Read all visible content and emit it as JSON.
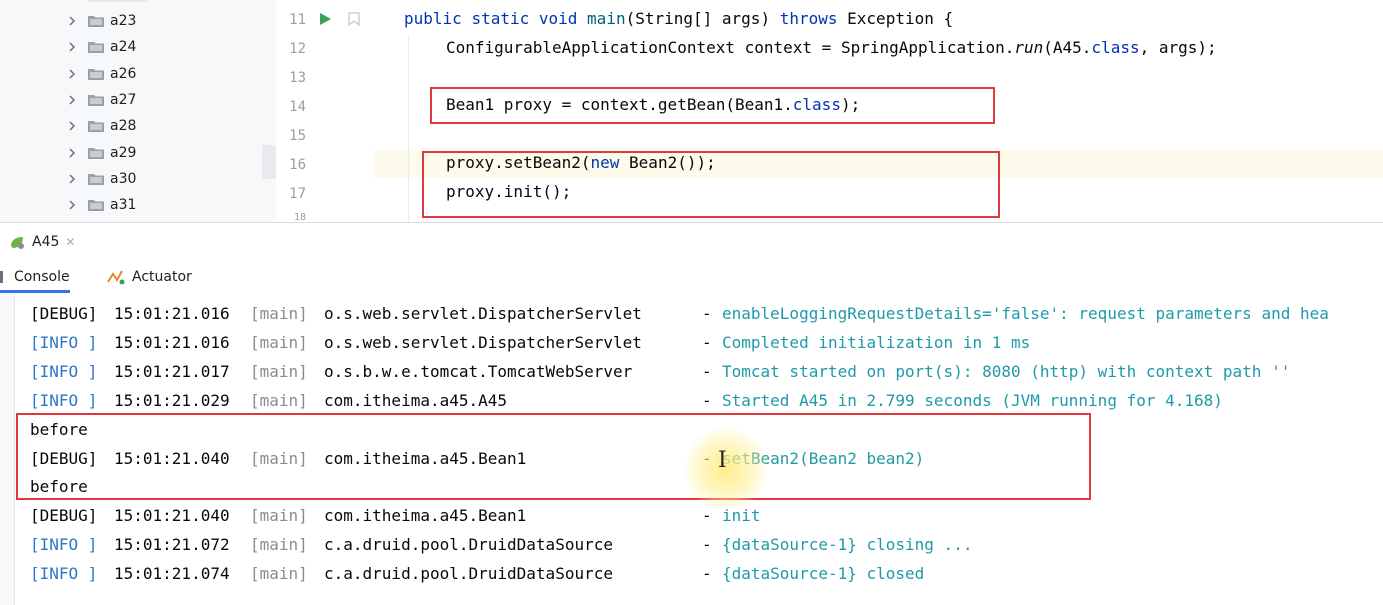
{
  "project_tree": {
    "items": [
      {
        "label": "a23"
      },
      {
        "label": "a24"
      },
      {
        "label": "a26"
      },
      {
        "label": "a27"
      },
      {
        "label": "a28"
      },
      {
        "label": "a29"
      },
      {
        "label": "a30"
      },
      {
        "label": "a31"
      }
    ]
  },
  "editor": {
    "line_numbers": [
      "11",
      "12",
      "13",
      "14",
      "15",
      "16",
      "17",
      "18"
    ],
    "code": {
      "l11_kw1": "public",
      "l11_kw2": "static",
      "l11_kw3": "void",
      "l11_fn": "main",
      "l11_args": "(String[] args)",
      "l11_kw4": "throws",
      "l11_rest": "Exception {",
      "l12_a": "ConfigurableApplicationContext context = SpringApplication.",
      "l12_run": "run",
      "l12_b": "(A45.",
      "l12_class": "class",
      "l12_c": ", args);",
      "l14_a": "Bean1 proxy = context.getBean(Bean1.",
      "l14_class": "class",
      "l14_b": ");",
      "l16_a": "proxy.setBean2(",
      "l16_new": "new",
      "l16_b": " Bean2());",
      "l17": "proxy.init();"
    }
  },
  "tool_window": {
    "run_tab": "A45",
    "subtabs": {
      "console": "Console",
      "actuator": "Actuator"
    }
  },
  "console": {
    "lines": [
      {
        "level": "[DEBUG]",
        "time": "15:01:21.016",
        "thread": "[main]",
        "logger": "o.s.web.servlet.DispatcherServlet",
        "msg": "enableLoggingRequestDetails='false': request parameters and hea"
      },
      {
        "level": "[INFO ]",
        "time": "15:01:21.016",
        "thread": "[main]",
        "logger": "o.s.web.servlet.DispatcherServlet",
        "msg": "Completed initialization in 1 ms"
      },
      {
        "level": "[INFO ]",
        "time": "15:01:21.017",
        "thread": "[main]",
        "logger": "o.s.b.w.e.tomcat.TomcatWebServer",
        "msg": "Tomcat started on port(s): 8080 (http) with context path ''"
      },
      {
        "level": "[INFO ]",
        "time": "15:01:21.029",
        "thread": "[main]",
        "logger": "com.itheima.a45.A45",
        "msg": "Started A45 in 2.799 seconds (JVM running for 4.168)"
      },
      {
        "plain": "before"
      },
      {
        "level": "[DEBUG]",
        "time": "15:01:21.040",
        "thread": "[main]",
        "logger": "com.itheima.a45.Bean1",
        "msg": "setBean2(Bean2 bean2)"
      },
      {
        "plain": "before"
      },
      {
        "level": "[DEBUG]",
        "time": "15:01:21.040",
        "thread": "[main]",
        "logger": "com.itheima.a45.Bean1",
        "msg": "init"
      },
      {
        "level": "[INFO ]",
        "time": "15:01:21.072",
        "thread": "[main]",
        "logger": "c.a.druid.pool.DruidDataSource",
        "msg": "{dataSource-1} closing ..."
      },
      {
        "level": "[INFO ]",
        "time": "15:01:21.074",
        "thread": "[main]",
        "logger": "c.a.druid.pool.DruidDataSource",
        "msg": "{dataSource-1} closed"
      }
    ],
    "dash": "-"
  },
  "colors": {
    "keyword": "#0033b3",
    "method": "#00627a",
    "info_level": "#2e76c9",
    "message": "#1f9aa8",
    "highlight_box": "#e0393e"
  },
  "icons": {
    "tree_chevron": "chevron-right-icon",
    "tree_folder": "folder-icon",
    "run_gutter": "run-icon",
    "bookmark_gutter": "bookmark-icon",
    "run_tab": "spring-boot-icon",
    "console_tab": "console-icon",
    "actuator_tab": "actuator-icon"
  }
}
